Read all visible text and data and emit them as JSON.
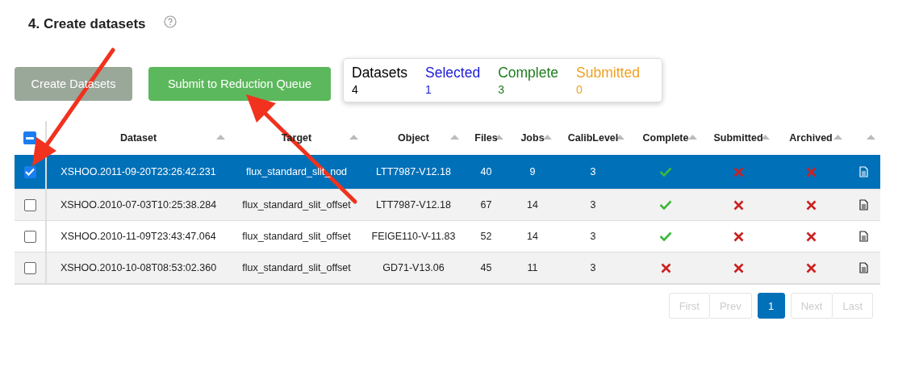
{
  "section": {
    "title": "4. Create datasets"
  },
  "buttons": [
    {
      "label": "Create Datasets",
      "disabled": true
    },
    {
      "label": "Submit to Reduction Queue",
      "disabled": false
    }
  ],
  "summary": [
    {
      "label": "Datasets",
      "value": "4",
      "color": "#000000"
    },
    {
      "label": "Selected",
      "value": "1",
      "color": "#1a1ad6"
    },
    {
      "label": "Complete",
      "value": "3",
      "color": "#1e7d1e"
    },
    {
      "label": "Submitted",
      "value": "0",
      "color": "#f0a020"
    }
  ],
  "table": {
    "select_all": {
      "partial": true
    },
    "columns": [
      "Dataset",
      "Target",
      "Object",
      "Files",
      "Jobs",
      "CalibLevel",
      "Complete",
      "Submitted",
      "Archived"
    ],
    "rows": [
      {
        "selected": true,
        "dataset": "XSHOO.2011-09-20T23:26:42.231",
        "target": "flux_standard_slit_nod",
        "object": "LTT7987-V12.18",
        "files": "40",
        "jobs": "9",
        "calib_level": "3",
        "complete": true,
        "submitted": false,
        "archived": false
      },
      {
        "selected": false,
        "dataset": "XSHOO.2010-07-03T10:25:38.284",
        "target": "flux_standard_slit_offset",
        "object": "LTT7987-V12.18",
        "files": "67",
        "jobs": "14",
        "calib_level": "3",
        "complete": true,
        "submitted": false,
        "archived": false
      },
      {
        "selected": false,
        "dataset": "XSHOO.2010-11-09T23:43:47.064",
        "target": "flux_standard_slit_offset",
        "object": "FEIGE110-V-11.83",
        "files": "52",
        "jobs": "14",
        "calib_level": "3",
        "complete": true,
        "submitted": false,
        "archived": false
      },
      {
        "selected": false,
        "dataset": "XSHOO.2010-10-08T08:53:02.360",
        "target": "flux_standard_slit_offset",
        "object": "GD71-V13.06",
        "files": "45",
        "jobs": "11",
        "calib_level": "3",
        "complete": false,
        "submitted": false,
        "archived": false
      }
    ]
  },
  "pagination": [
    {
      "label": "First",
      "disabled": true,
      "selected": false
    },
    {
      "label": "Prev",
      "disabled": true,
      "selected": false
    },
    {
      "label": "1",
      "disabled": false,
      "selected": true
    },
    {
      "label": "Next",
      "disabled": true,
      "selected": false
    },
    {
      "label": "Last",
      "disabled": true,
      "selected": false
    }
  ]
}
